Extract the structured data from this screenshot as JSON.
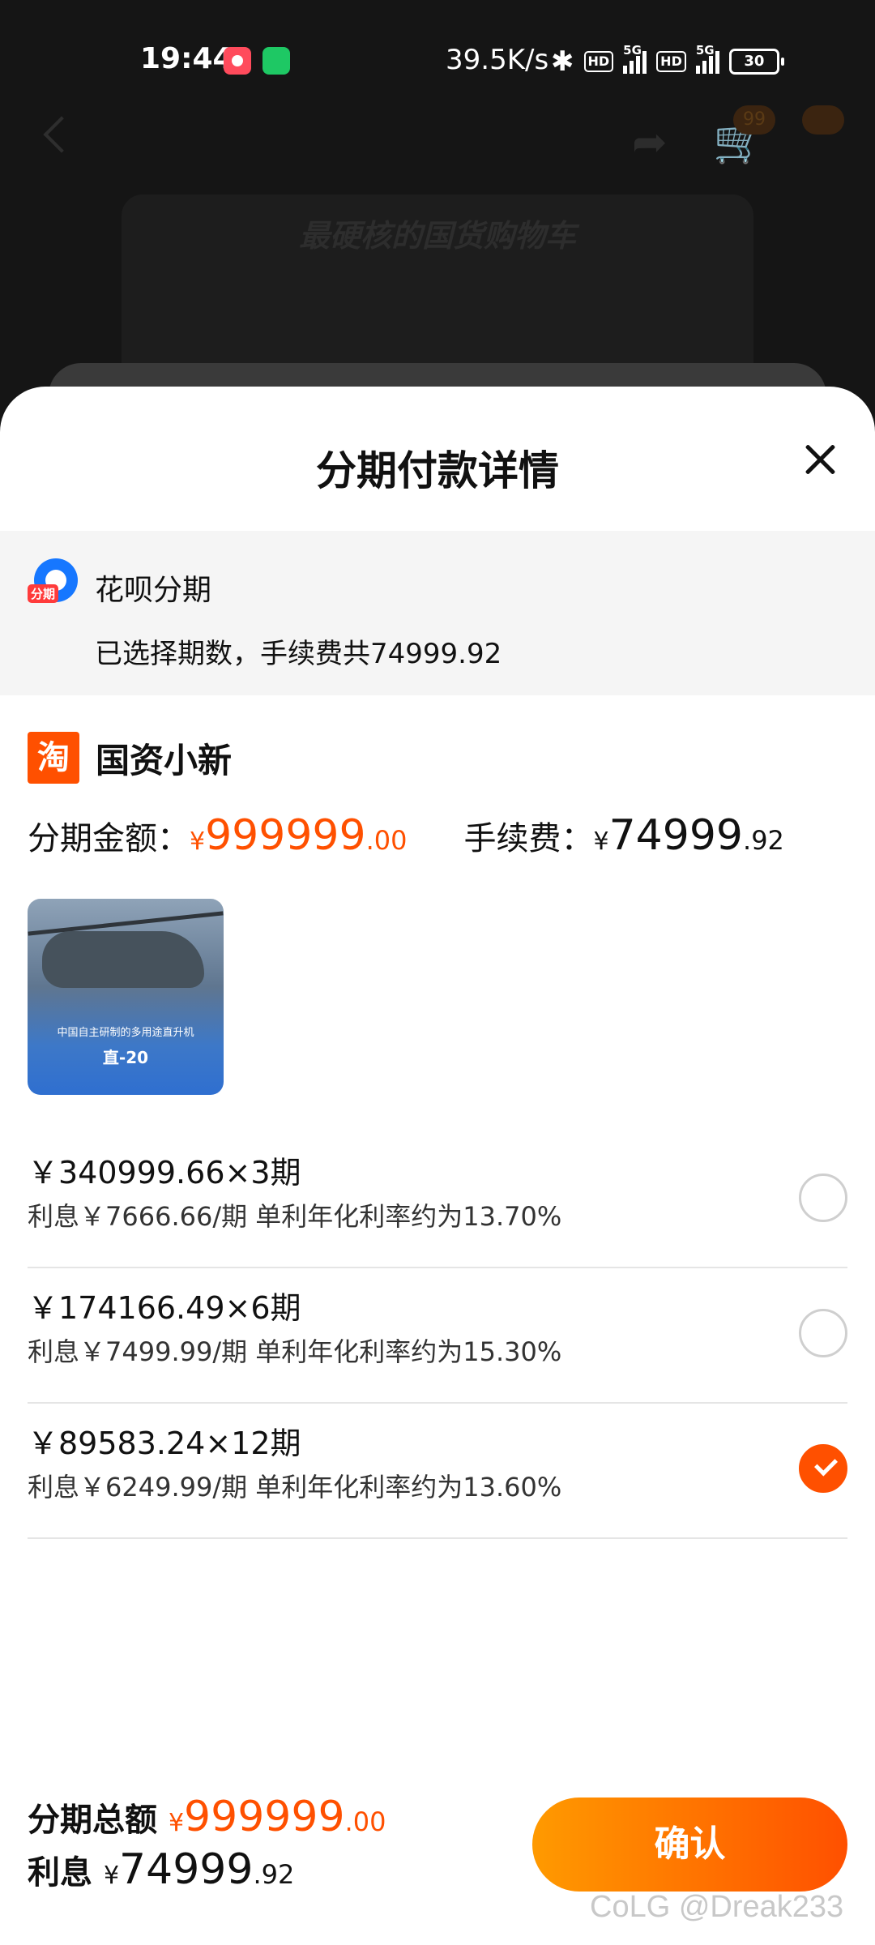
{
  "status_bar": {
    "time": "19:44",
    "network_speed": "39.5K/s",
    "hd_label": "HD",
    "network_type": "5G",
    "battery": "30"
  },
  "background_page": {
    "banner_title": "最硬核的国货购物车",
    "cart_badge": "99"
  },
  "sheet": {
    "title": "分期付款详情",
    "payment_method": {
      "logo_tag": "分期",
      "name": "花呗分期",
      "description": "已选择期数，手续费共74999.92"
    },
    "store": {
      "logo_char": "淘",
      "name": "国资小新"
    },
    "amounts": {
      "installment_label": "分期金额：",
      "currency": "¥",
      "installment_int": "999999",
      "installment_dec": ".00",
      "fee_label": "手续费：",
      "fee_int": "74999",
      "fee_dec": ".92"
    },
    "product_image": {
      "caption": "中国自主研制的多用途直升机",
      "model": "直-20"
    },
    "plans": [
      {
        "main": "￥340999.66×3期",
        "sub": "利息￥7666.66/期 单利年化利率约为13.70%",
        "selected": false
      },
      {
        "main": "￥174166.49×6期",
        "sub": "利息￥7499.99/期 单利年化利率约为15.30%",
        "selected": false
      },
      {
        "main": "￥89583.24×12期",
        "sub": "利息￥6249.99/期 单利年化利率约为13.60%",
        "selected": true
      }
    ],
    "footer": {
      "total_label": "分期总额",
      "total_int": "999999",
      "total_dec": ".00",
      "interest_label": "利息",
      "interest_int": "74999",
      "interest_dec": ".92",
      "confirm_label": "确认"
    },
    "watermark": "CoLG @Dreak233"
  },
  "colors": {
    "accent": "#ff5000",
    "accent_gradient_start": "#ff9a00",
    "huabei_blue": "#1677ff"
  }
}
